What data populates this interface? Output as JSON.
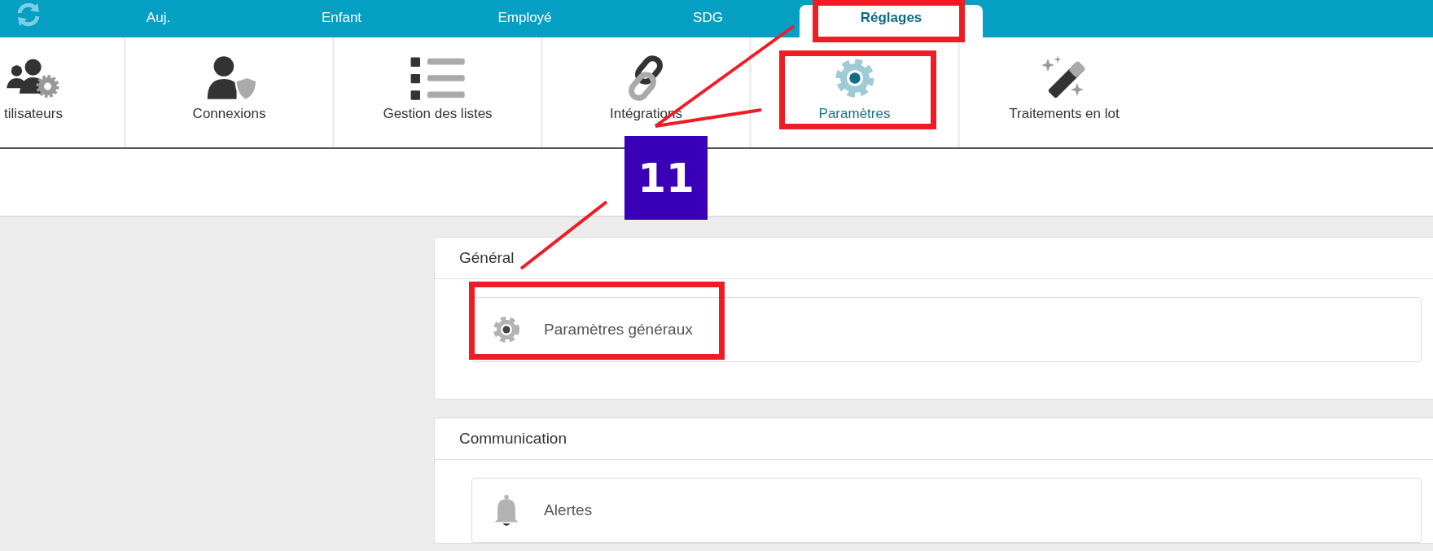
{
  "tabs": [
    {
      "label": "Auj.",
      "selected": false
    },
    {
      "label": "Enfant",
      "selected": false
    },
    {
      "label": "Employé",
      "selected": false
    },
    {
      "label": "SDG",
      "selected": false
    },
    {
      "label": "Réglages",
      "selected": true
    }
  ],
  "toolbar": {
    "items": [
      {
        "label": "tilisateurs",
        "selected": false
      },
      {
        "label": "Connexions",
        "selected": false
      },
      {
        "label": "Gestion des listes",
        "selected": false
      },
      {
        "label": "Intégrations",
        "selected": false
      },
      {
        "label": "Paramètres",
        "selected": true
      },
      {
        "label": "Traitements en lot",
        "selected": false
      }
    ]
  },
  "sections": [
    {
      "title": "Général",
      "items": [
        {
          "label": "Paramètres généraux"
        }
      ]
    },
    {
      "title": "Communication",
      "items": [
        {
          "label": "Alertes"
        }
      ]
    }
  ],
  "annotation": {
    "step_number": "11"
  }
}
